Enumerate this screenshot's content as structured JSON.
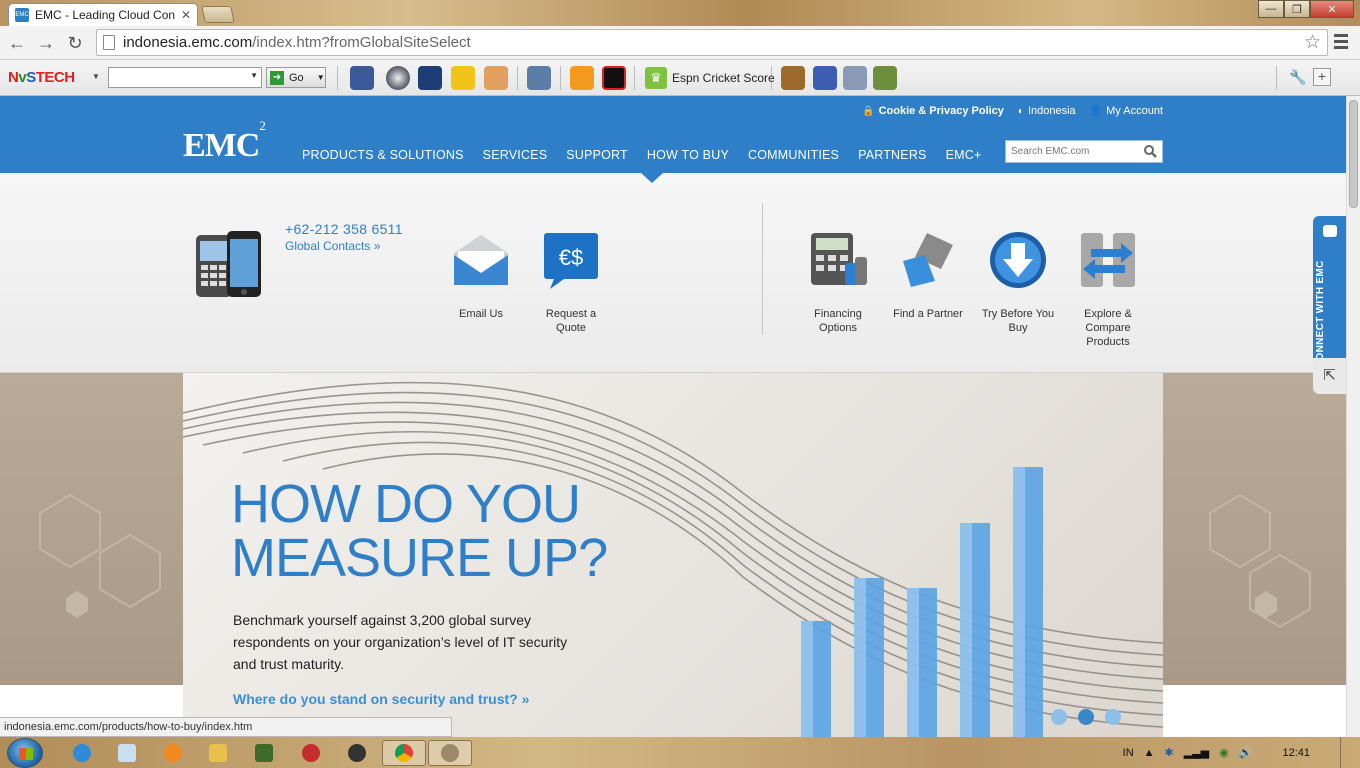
{
  "browser": {
    "tab_title": "EMC - Leading Cloud Con",
    "url_host": "indonesia.emc.com",
    "url_path": "/index.htm?fromGlobalSiteSelect",
    "status_url": "indonesia.emc.com/products/how-to-buy/index.htm"
  },
  "toolbar": {
    "brand_a": "N",
    "brand_b": "v",
    "brand_c": "S",
    "brand_d": "TECH",
    "go_label": "Go",
    "cricket_label": "Espn Cricket Score"
  },
  "site": {
    "top_links": {
      "cookie": "Cookie & Privacy Policy",
      "country": "Indonesia",
      "account": "My Account"
    },
    "logo": "EMC",
    "logo_sup": "2",
    "nav": [
      "PRODUCTS & SOLUTIONS",
      "SERVICES",
      "SUPPORT",
      "HOW TO BUY",
      "COMMUNITIES",
      "PARTNERS",
      "EMC+"
    ],
    "search_placeholder": "Search EMC.com"
  },
  "dropdown": {
    "phone": "+62-212 358 6511",
    "global_contacts": "Global Contacts »",
    "left_items": [
      {
        "line1": "Email Us",
        "line2": ""
      },
      {
        "line1": "Request a",
        "line2": "Quote"
      }
    ],
    "right_items": [
      {
        "line1": "Financing",
        "line2": "Options",
        "line3": ""
      },
      {
        "line1": "Find a Partner",
        "line2": "",
        "line3": ""
      },
      {
        "line1": "Try Before You",
        "line2": "Buy",
        "line3": ""
      },
      {
        "line1": "Explore &",
        "line2": "Compare",
        "line3": "Products"
      }
    ]
  },
  "hero": {
    "headline_line1": "HOW DO YOU",
    "headline_line2": "MEASURE UP?",
    "body": "Benchmark yourself against 3,200 global survey respondents on your organization’s level of IT security and trust maturity.",
    "cta": "Where do you stand on security and trust? »",
    "slides_total": 3,
    "slide_active": 2
  },
  "connect": {
    "label": "CONNECT WITH EMC"
  },
  "taskbar": {
    "lang": "IN",
    "time": "12:41"
  },
  "colors": {
    "emc_blue": "#2f7fc8",
    "link_blue": "#3a8fd6"
  }
}
